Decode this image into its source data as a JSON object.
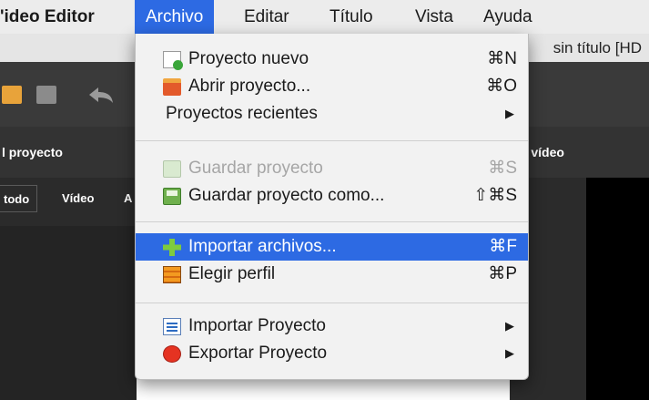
{
  "menubar": {
    "app_name": "'ideo Editor",
    "items": [
      "Archivo",
      "Editar",
      "Título",
      "Vista",
      "Ayuda"
    ],
    "active_index": 0
  },
  "window": {
    "title_fragment": "sin título [HD"
  },
  "panels": {
    "left_header": "l proyecto",
    "right_header": "r vídeo",
    "filters": [
      "todo",
      "Vídeo",
      "A"
    ]
  },
  "archivo_menu": {
    "items": [
      {
        "label": "Proyecto nuevo",
        "shortcut": "⌘N",
        "icon": "new-project-icon",
        "enabled": true
      },
      {
        "label": "Abrir proyecto...",
        "shortcut": "⌘O",
        "icon": "open-project-icon",
        "enabled": true
      },
      {
        "label": "Proyectos recientes",
        "submenu": "▶",
        "enabled": true
      },
      {
        "label": "Guardar proyecto",
        "shortcut": "⌘S",
        "icon": "save-project-icon",
        "enabled": false
      },
      {
        "label": "Guardar proyecto como...",
        "shortcut": "⇧⌘S",
        "icon": "save-as-icon",
        "enabled": true
      },
      {
        "label": "Importar archivos...",
        "shortcut": "⌘F",
        "icon": "import-files-icon",
        "enabled": true,
        "highlighted": true
      },
      {
        "label": "Elegir perfil",
        "shortcut": "⌘P",
        "icon": "profile-icon",
        "enabled": true
      },
      {
        "label": "Importar Proyecto",
        "submenu": "▶",
        "icon": "import-project-icon",
        "enabled": true
      },
      {
        "label": "Exportar Proyecto",
        "submenu": "▶",
        "icon": "export-project-icon",
        "enabled": true
      }
    ]
  },
  "colors": {
    "highlight": "#2d6ae3",
    "menu_bg": "#f2f2f2",
    "dark_panel": "#2b2b2b"
  }
}
